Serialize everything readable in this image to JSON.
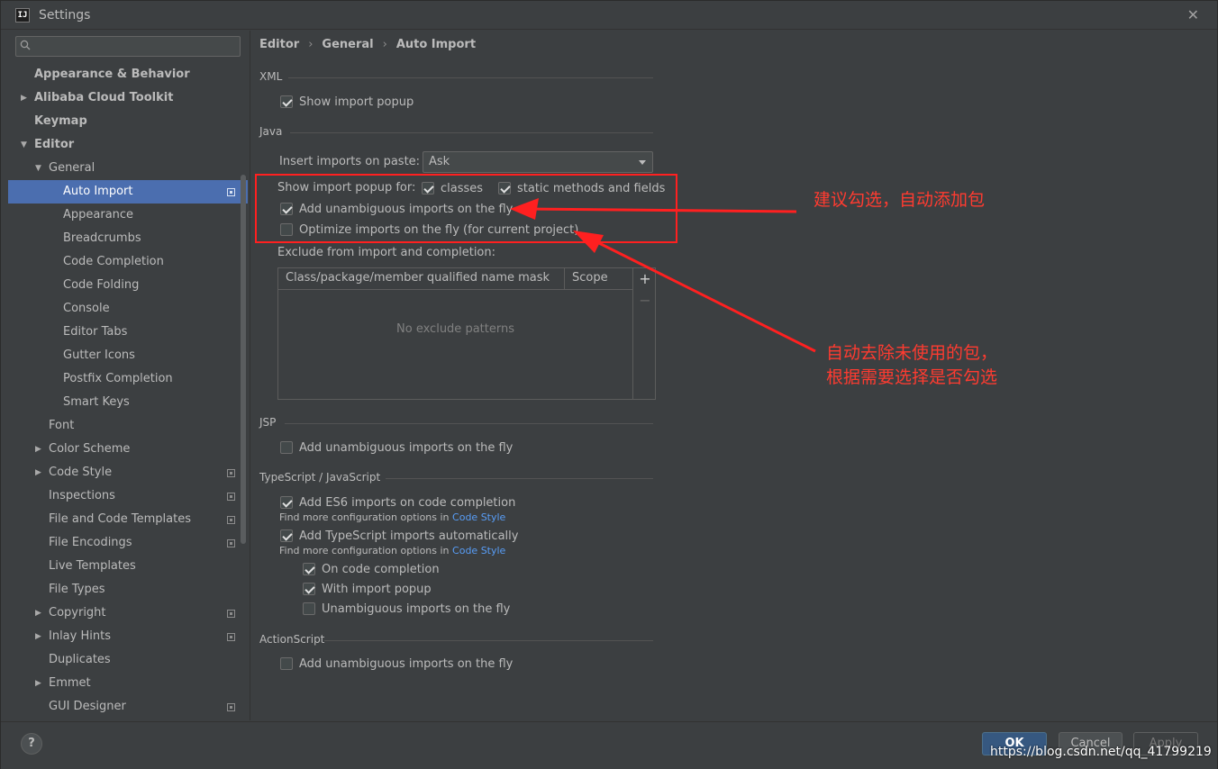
{
  "window": {
    "title": "Settings",
    "app_icon_text": "IJ"
  },
  "search": {
    "placeholder": "",
    "value": ""
  },
  "sidebar": {
    "items": [
      {
        "label": "Appearance & Behavior",
        "bold": true,
        "level": 0,
        "arrow": ""
      },
      {
        "label": "Alibaba Cloud Toolkit",
        "bold": true,
        "level": 0,
        "arrow": "right"
      },
      {
        "label": "Keymap",
        "bold": true,
        "level": 0,
        "arrow": ""
      },
      {
        "label": "Editor",
        "bold": true,
        "level": 0,
        "arrow": "down"
      },
      {
        "label": "General",
        "bold": false,
        "level": 1,
        "arrow": "down"
      },
      {
        "label": "Auto Import",
        "bold": false,
        "level": 2,
        "arrow": "",
        "selected": true,
        "project": true
      },
      {
        "label": "Appearance",
        "bold": false,
        "level": 2,
        "arrow": ""
      },
      {
        "label": "Breadcrumbs",
        "bold": false,
        "level": 2,
        "arrow": ""
      },
      {
        "label": "Code Completion",
        "bold": false,
        "level": 2,
        "arrow": ""
      },
      {
        "label": "Code Folding",
        "bold": false,
        "level": 2,
        "arrow": ""
      },
      {
        "label": "Console",
        "bold": false,
        "level": 2,
        "arrow": ""
      },
      {
        "label": "Editor Tabs",
        "bold": false,
        "level": 2,
        "arrow": ""
      },
      {
        "label": "Gutter Icons",
        "bold": false,
        "level": 2,
        "arrow": ""
      },
      {
        "label": "Postfix Completion",
        "bold": false,
        "level": 2,
        "arrow": ""
      },
      {
        "label": "Smart Keys",
        "bold": false,
        "level": 2,
        "arrow": ""
      },
      {
        "label": "Font",
        "bold": false,
        "level": 1,
        "arrow": ""
      },
      {
        "label": "Color Scheme",
        "bold": false,
        "level": 1,
        "arrow": "right"
      },
      {
        "label": "Code Style",
        "bold": false,
        "level": 1,
        "arrow": "right",
        "project": true
      },
      {
        "label": "Inspections",
        "bold": false,
        "level": 1,
        "arrow": "",
        "project": true
      },
      {
        "label": "File and Code Templates",
        "bold": false,
        "level": 1,
        "arrow": "",
        "project": true
      },
      {
        "label": "File Encodings",
        "bold": false,
        "level": 1,
        "arrow": "",
        "project": true
      },
      {
        "label": "Live Templates",
        "bold": false,
        "level": 1,
        "arrow": ""
      },
      {
        "label": "File Types",
        "bold": false,
        "level": 1,
        "arrow": ""
      },
      {
        "label": "Copyright",
        "bold": false,
        "level": 1,
        "arrow": "right",
        "project": true
      },
      {
        "label": "Inlay Hints",
        "bold": false,
        "level": 1,
        "arrow": "right",
        "project": true
      },
      {
        "label": "Duplicates",
        "bold": false,
        "level": 1,
        "arrow": ""
      },
      {
        "label": "Emmet",
        "bold": false,
        "level": 1,
        "arrow": "right"
      },
      {
        "label": "GUI Designer",
        "bold": false,
        "level": 1,
        "arrow": "",
        "project": true
      }
    ]
  },
  "breadcrumb": {
    "part1": "Editor",
    "part2": "General",
    "part3": "Auto Import",
    "sep": "›"
  },
  "xml": {
    "title": "XML",
    "show_import_popup": "Show import popup"
  },
  "java": {
    "title": "Java",
    "insert_label": "Insert imports on paste:",
    "insert_value": "Ask",
    "show_popup_for": "Show import popup for:",
    "classes": "classes",
    "static_methods": "static methods and fields",
    "add_unambiguous": "Add unambiguous imports on the fly",
    "optimize": "Optimize imports on the fly (for current project)",
    "exclude_label": "Exclude from import and completion:",
    "col_mask": "Class/package/member qualified name mask",
    "col_scope": "Scope",
    "empty_text": "No exclude patterns",
    "add_tool": "+",
    "remove_tool": "−"
  },
  "jsp": {
    "title": "JSP",
    "add_unambiguous": "Add unambiguous imports on the fly"
  },
  "ts": {
    "title": "TypeScript / JavaScript",
    "add_es6": "Add ES6 imports on code completion",
    "hint_prefix": "Find more configuration options in ",
    "hint_link": "Code Style",
    "add_ts": "Add TypeScript imports automatically",
    "on_completion": "On code completion",
    "with_popup": "With import popup",
    "unambiguous": "Unambiguous imports on the fly"
  },
  "actionscript": {
    "title": "ActionScript",
    "add_unambiguous": "Add unambiguous imports on the fly"
  },
  "annotations": {
    "note1": "建议勾选，自动添加包",
    "note2_line1": "自动去除未使用的包，",
    "note2_line2": "根据需要选择是否勾选",
    "color": "#ff2020"
  },
  "footer": {
    "help": "?",
    "ok": "OK",
    "cancel": "Cancel",
    "apply": "Apply",
    "watermark": "https://blog.csdn.net/qq_41799219"
  }
}
